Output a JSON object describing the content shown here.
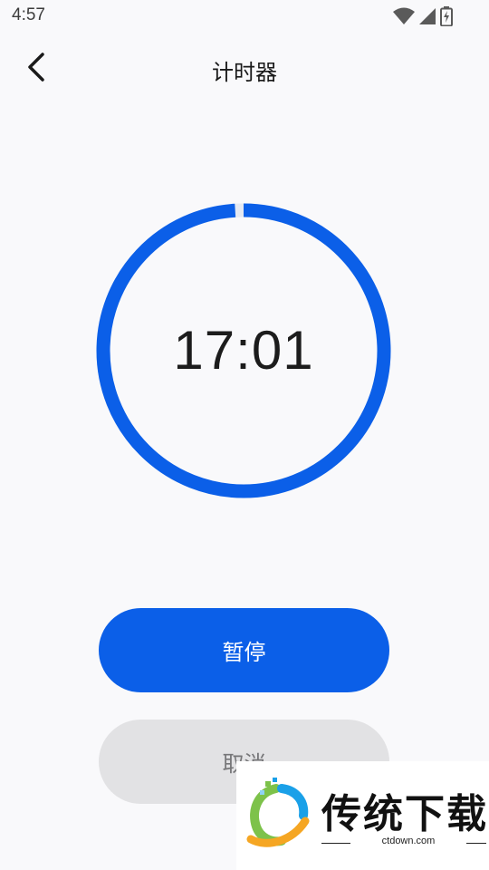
{
  "status_bar": {
    "time": "4:57",
    "icons": [
      "wifi-icon",
      "signal-icon",
      "battery-charging-icon"
    ]
  },
  "header": {
    "title": "计时器",
    "back_icon": "chevron-left-icon"
  },
  "timer": {
    "display": "17:01",
    "progress_fraction": 0.99
  },
  "actions": {
    "pause_label": "暂停",
    "cancel_label": "取消"
  },
  "watermark": {
    "brand": "传统下载",
    "url": "ctdown.com"
  },
  "colors": {
    "accent": "#0b5fe8",
    "background": "#f9f9fb",
    "cancel_bg": "#e2e2e4",
    "cancel_text": "#767678"
  }
}
